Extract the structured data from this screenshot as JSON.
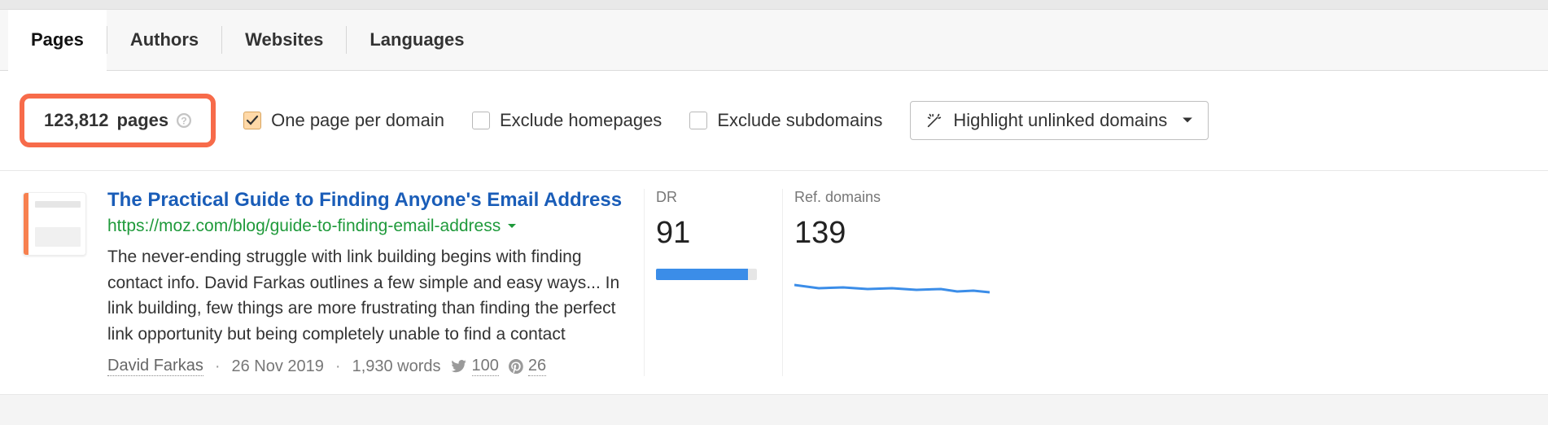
{
  "tabs": {
    "pages": "Pages",
    "authors": "Authors",
    "websites": "Websites",
    "languages": "Languages",
    "active": "pages"
  },
  "summary": {
    "count": "123,812",
    "count_label": "pages"
  },
  "filters": {
    "one_per_domain": {
      "label": "One page per domain",
      "checked": true
    },
    "exclude_homepages": {
      "label": "Exclude homepages",
      "checked": false
    },
    "exclude_subdomains": {
      "label": "Exclude subdomains",
      "checked": false
    },
    "highlight_dropdown": "Highlight unlinked domains"
  },
  "result": {
    "title": "The Practical Guide to Finding Anyone's Email Address",
    "url": "https://moz.com/blog/guide-to-finding-email-address",
    "description": "The never-ending struggle with link building begins with finding contact info. David Farkas outlines a few simple and easy ways... In link building, few things are more frustrating than finding the perfect link opportunity but being completely unable to find a contact",
    "author": "David Farkas",
    "date": "26 Nov 2019",
    "words": "1,930 words",
    "twitter": "100",
    "pinterest": "26",
    "dr": {
      "label": "DR",
      "value": "91"
    },
    "ref_domains": {
      "label": "Ref. domains",
      "value": "139"
    }
  }
}
